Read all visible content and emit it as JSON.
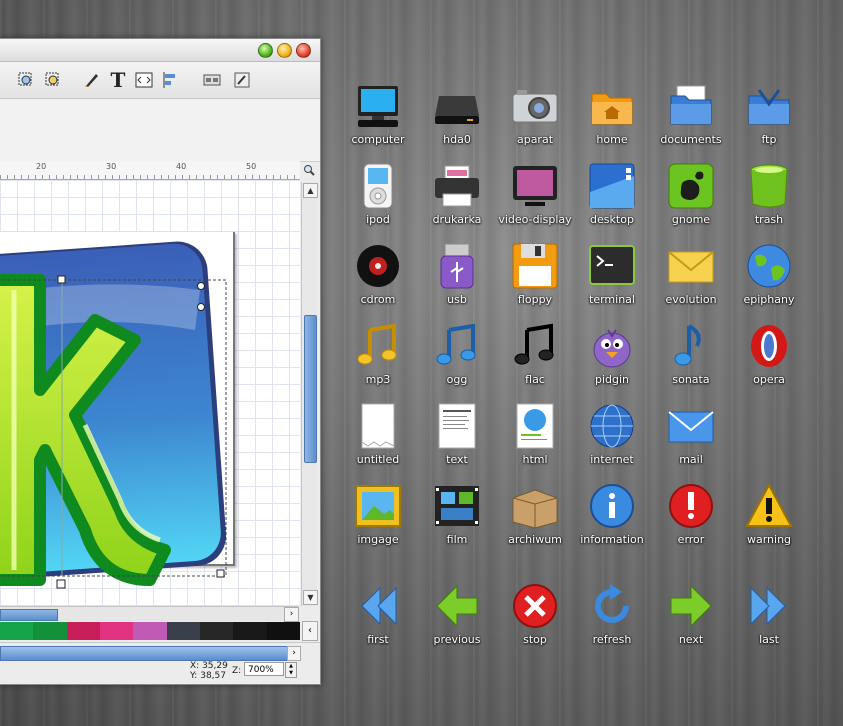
{
  "window": {
    "ruler_ticks": [
      "20",
      "30",
      "40",
      "50"
    ],
    "status": {
      "x_label": "X:",
      "x_value": "35,29",
      "y_label": "Y:",
      "y_value": "38,57",
      "zoom_label": "Z:",
      "zoom_value": "700%"
    },
    "palette": [
      "#16a44a",
      "#139139",
      "#c81f5a",
      "#e23282",
      "#c05ab4",
      "#39404c",
      "#272727",
      "#181818",
      "#101010"
    ]
  },
  "icons": [
    {
      "label": "computer",
      "icon": "computer-icon"
    },
    {
      "label": "hda0",
      "icon": "harddisk-icon"
    },
    {
      "label": "aparat",
      "icon": "camera-icon"
    },
    {
      "label": "home",
      "icon": "home-folder-icon"
    },
    {
      "label": "documents",
      "icon": "documents-folder-icon"
    },
    {
      "label": "ftp",
      "icon": "ftp-folder-icon"
    },
    {
      "label": "ipod",
      "icon": "ipod-icon"
    },
    {
      "label": "drukarka",
      "icon": "printer-icon"
    },
    {
      "label": "video-display",
      "icon": "video-display-icon"
    },
    {
      "label": "desktop",
      "icon": "desktop-icon"
    },
    {
      "label": "gnome",
      "icon": "gnome-icon"
    },
    {
      "label": "trash",
      "icon": "trash-icon"
    },
    {
      "label": "cdrom",
      "icon": "cdrom-icon"
    },
    {
      "label": "usb",
      "icon": "usb-icon"
    },
    {
      "label": "floppy",
      "icon": "floppy-icon"
    },
    {
      "label": "terminal",
      "icon": "terminal-icon"
    },
    {
      "label": "evolution",
      "icon": "mail-envelope-icon"
    },
    {
      "label": "epiphany",
      "icon": "globe-icon"
    },
    {
      "label": "mp3",
      "icon": "music-note-yellow-icon"
    },
    {
      "label": "ogg",
      "icon": "music-note-blue-icon"
    },
    {
      "label": "flac",
      "icon": "music-note-black-icon"
    },
    {
      "label": "pidgin",
      "icon": "pidgin-bird-icon"
    },
    {
      "label": "sonata",
      "icon": "music-note-single-icon"
    },
    {
      "label": "opera",
      "icon": "opera-icon"
    },
    {
      "label": "untitled",
      "icon": "blank-document-icon"
    },
    {
      "label": "text",
      "icon": "text-document-icon"
    },
    {
      "label": "html",
      "icon": "html-document-icon"
    },
    {
      "label": "internet",
      "icon": "internet-globe-icon"
    },
    {
      "label": "mail",
      "icon": "mail-icon"
    },
    {
      "label": "",
      "icon": ""
    },
    {
      "label": "imgage",
      "icon": "image-frame-icon"
    },
    {
      "label": "film",
      "icon": "film-icon"
    },
    {
      "label": "archiwum",
      "icon": "archive-box-icon"
    },
    {
      "label": "information",
      "icon": "information-icon"
    },
    {
      "label": "error",
      "icon": "error-icon"
    },
    {
      "label": "warning",
      "icon": "warning-icon"
    },
    {
      "label": "first",
      "icon": "first-arrow-icon"
    },
    {
      "label": "previous",
      "icon": "previous-arrow-icon"
    },
    {
      "label": "stop",
      "icon": "stop-icon"
    },
    {
      "label": "refresh",
      "icon": "refresh-icon"
    },
    {
      "label": "next",
      "icon": "next-arrow-icon"
    },
    {
      "label": "last",
      "icon": "last-arrow-icon"
    }
  ]
}
